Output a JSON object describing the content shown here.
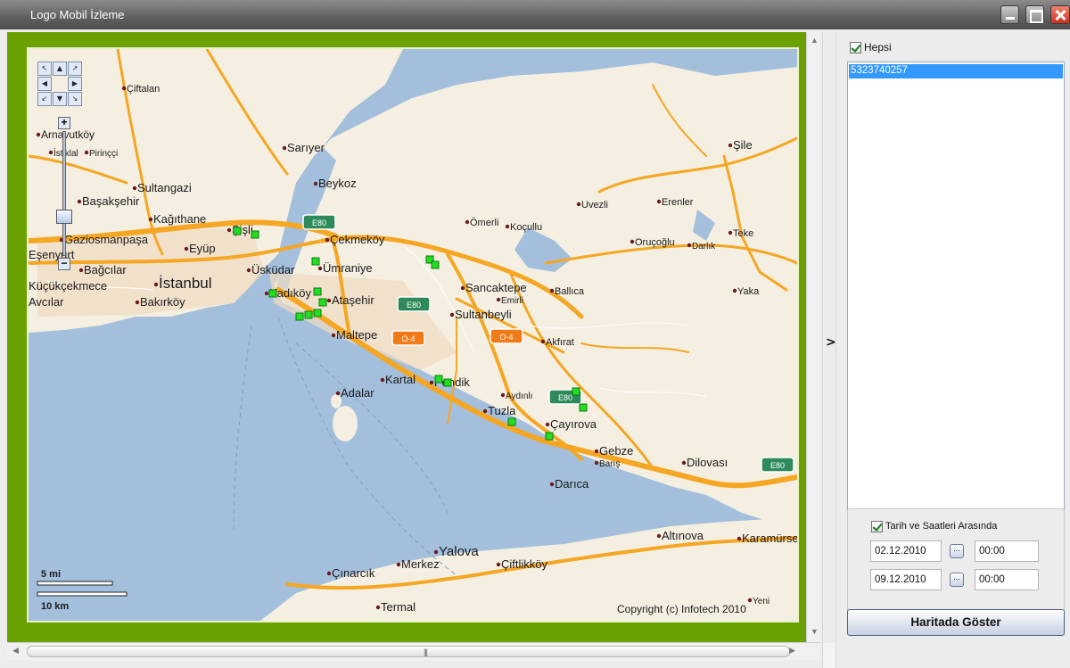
{
  "window": {
    "title": "Logo Mobil İzleme"
  },
  "map": {
    "places": [
      {
        "name": "Arnavutköy",
        "size": 12
      },
      {
        "name": "Çiftalan",
        "size": 11
      },
      {
        "name": "İstiklal",
        "size": 10
      },
      {
        "name": "Pirinççi",
        "size": 10
      },
      {
        "name": "Sarıyer",
        "size": 13
      },
      {
        "name": "Şile",
        "size": 13
      },
      {
        "name": "Sultangazi",
        "size": 13
      },
      {
        "name": "Başakşehir",
        "size": 13
      },
      {
        "name": "Beykoz",
        "size": 13
      },
      {
        "name": "Kağıthane",
        "size": 13
      },
      {
        "name": "Gaziosmanpaşa",
        "size": 13
      },
      {
        "name": "Eyüp",
        "size": 13
      },
      {
        "name": "Bağcılar",
        "size": 13
      },
      {
        "name": "İstanbul",
        "size": 17
      },
      {
        "name": "Üsküdar",
        "size": 13
      },
      {
        "name": "Çekmeköy",
        "size": 13
      },
      {
        "name": "Ümraniye",
        "size": 13
      },
      {
        "name": "Kadıköy",
        "size": 13
      },
      {
        "name": "Ataşehir",
        "size": 13
      },
      {
        "name": "Bakırköy",
        "size": 13
      },
      {
        "name": "Maltepe",
        "size": 13
      },
      {
        "name": "Sancaktepe",
        "size": 13
      },
      {
        "name": "Emirli",
        "size": 10
      },
      {
        "name": "Sultanbeyli",
        "size": 13
      },
      {
        "name": "Ömerli",
        "size": 11
      },
      {
        "name": "Koçullu",
        "size": 11
      },
      {
        "name": "Uvezli",
        "size": 11
      },
      {
        "name": "Erenler",
        "size": 11
      },
      {
        "name": "Oruçoğlu",
        "size": 11
      },
      {
        "name": "Darlık",
        "size": 10
      },
      {
        "name": "Teke",
        "size": 11
      },
      {
        "name": "Ballıca",
        "size": 11
      },
      {
        "name": "Yaka",
        "size": 11
      },
      {
        "name": "Akfırat",
        "size": 11
      },
      {
        "name": "Kartal",
        "size": 13
      },
      {
        "name": "Pendik",
        "size": 13
      },
      {
        "name": "Adalar",
        "size": 13
      },
      {
        "name": "Aydınlı",
        "size": 10
      },
      {
        "name": "Tuzla",
        "size": 13
      },
      {
        "name": "Çayırova",
        "size": 13
      },
      {
        "name": "Gebze",
        "size": 13
      },
      {
        "name": "Barış",
        "size": 10
      },
      {
        "name": "Dilovası",
        "size": 13
      },
      {
        "name": "Darıca",
        "size": 13
      },
      {
        "name": "Altınova",
        "size": 13
      },
      {
        "name": "Karamürsel",
        "size": 13
      },
      {
        "name": "Yalova",
        "size": 15
      },
      {
        "name": "Merkez",
        "size": 13
      },
      {
        "name": "Çiftlikköy",
        "size": 13
      },
      {
        "name": "Çınarcık",
        "size": 13
      },
      {
        "name": "Termal",
        "size": 13
      },
      {
        "name": "Yeni",
        "size": 10
      },
      {
        "name": "Küçükçekmece",
        "size": 13
      },
      {
        "name": "Avcılar",
        "size": 13
      },
      {
        "name": "Eşenyurt",
        "size": 13
      },
      {
        "name": "Şişli",
        "size": 13
      }
    ],
    "road_shields": [
      {
        "label": "E80",
        "color": "#2e8a5a"
      },
      {
        "label": "E80",
        "color": "#2e8a5a"
      },
      {
        "label": "O-4",
        "color": "#f07a18"
      },
      {
        "label": "O-4",
        "color": "#f07a18"
      },
      {
        "label": "E80",
        "color": "#2e8a5a"
      },
      {
        "label": "E80",
        "color": "#2e8a5a"
      }
    ],
    "scale": {
      "miles_label": "5 mi",
      "km_label": "10 km"
    },
    "copyright": "Copyright (c) Infotech 2010",
    "zoom_in": "+",
    "zoom_out": "−",
    "pan_arrows": [
      "↖",
      "▲",
      "↗",
      "◀",
      "▶",
      "↙",
      "▼",
      "↘"
    ],
    "marker_color": "#22dd22"
  },
  "sidebar": {
    "select_all": {
      "label": "Hepsi",
      "checked": true
    },
    "devices": [
      "5323740257"
    ],
    "date_filter": {
      "label": "Tarih ve Saatleri Arasında",
      "checked": true,
      "start_date": "02.12.2010",
      "start_time": "00:00",
      "end_date": "09.12.2010",
      "end_time": "00:00",
      "picker_label": "..."
    },
    "show_button": "Haritada Göster",
    "collapse_toggle": ">"
  },
  "scrollbar": {
    "grip": "|||"
  }
}
